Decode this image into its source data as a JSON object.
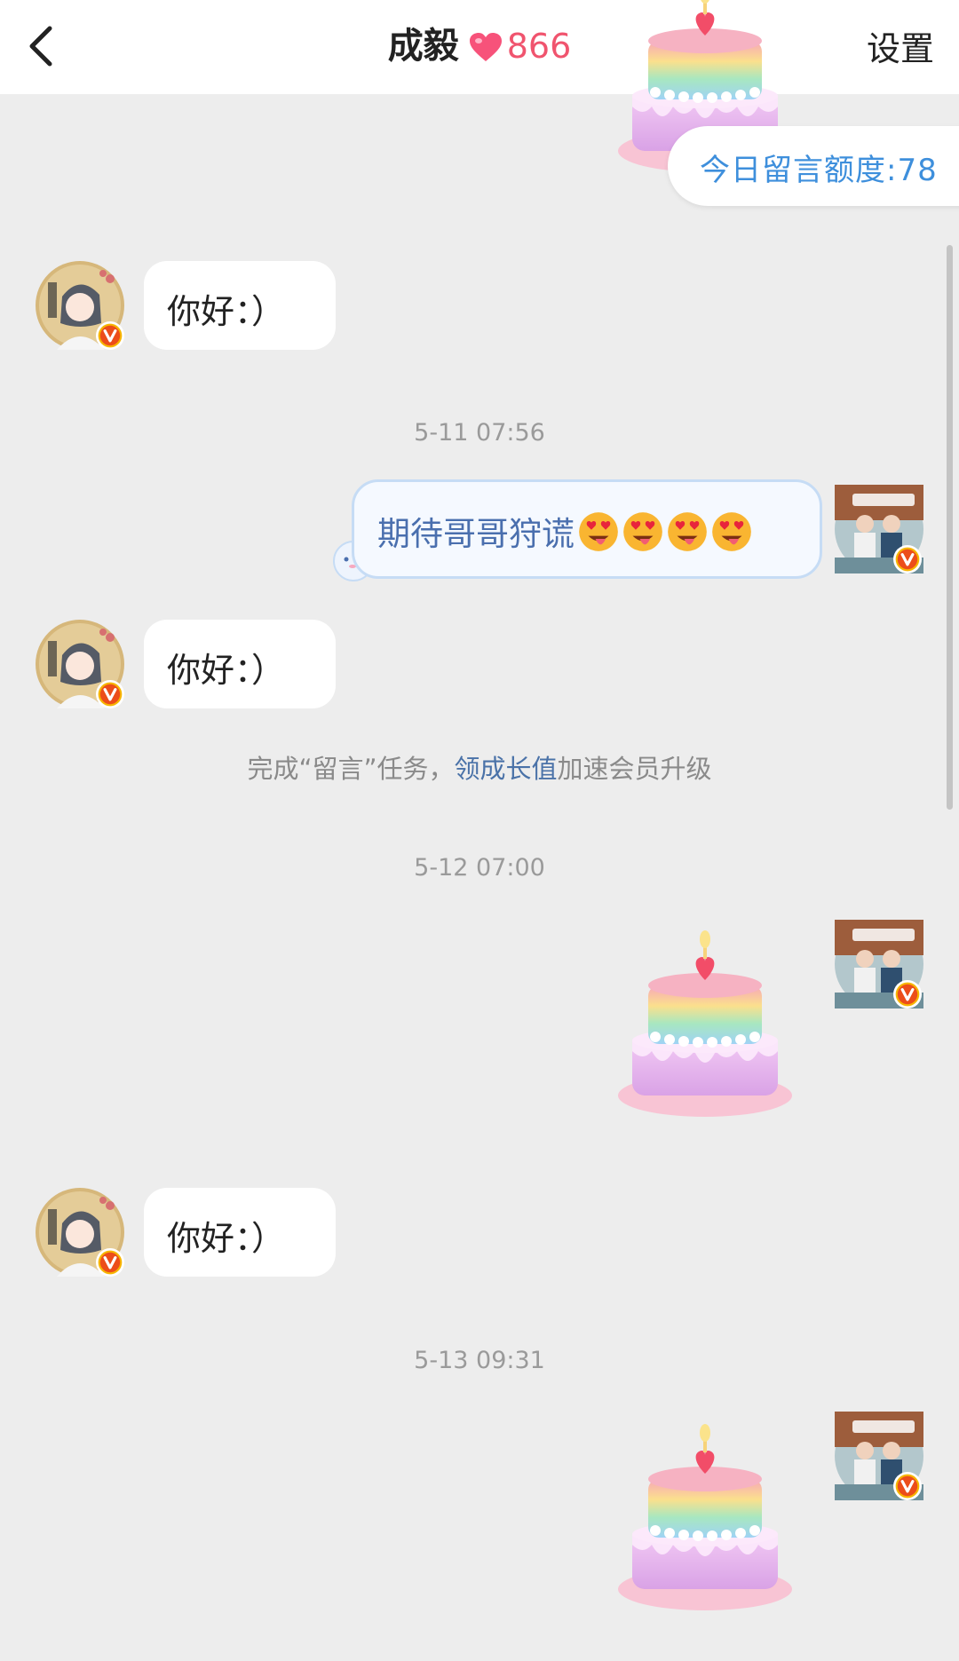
{
  "header": {
    "back_icon": "chevron-left-icon",
    "contact_name": "成毅",
    "heart_icon": "heart-icon",
    "intimacy_value": "866",
    "settings_label": "设置"
  },
  "quota": {
    "label": "今日留言额度:78"
  },
  "colors": {
    "accent_blue": "#3e8fdc",
    "intimacy_red": "#f0546e",
    "background": "#ededed"
  },
  "messages": [
    {
      "side": "incoming",
      "text": "你好：）"
    },
    {
      "timestamp": "5-11 07:56"
    },
    {
      "side": "outgoing",
      "text": "期待哥哥狩谎",
      "emoji_count": 4,
      "emoji": "heart-eyes-tongue-emoji"
    },
    {
      "side": "incoming",
      "text": "你好：）"
    },
    {
      "system_tip": {
        "before": "完成“留言”任务，",
        "link": "领成长值",
        "after": "加速会员升级"
      }
    },
    {
      "timestamp": "5-12 07:00"
    },
    {
      "side": "outgoing",
      "sticker": "birthday-cake-sticker"
    },
    {
      "side": "incoming",
      "text": "你好：）"
    },
    {
      "timestamp": "5-13 09:31"
    },
    {
      "side": "outgoing",
      "sticker": "birthday-cake-sticker"
    }
  ]
}
